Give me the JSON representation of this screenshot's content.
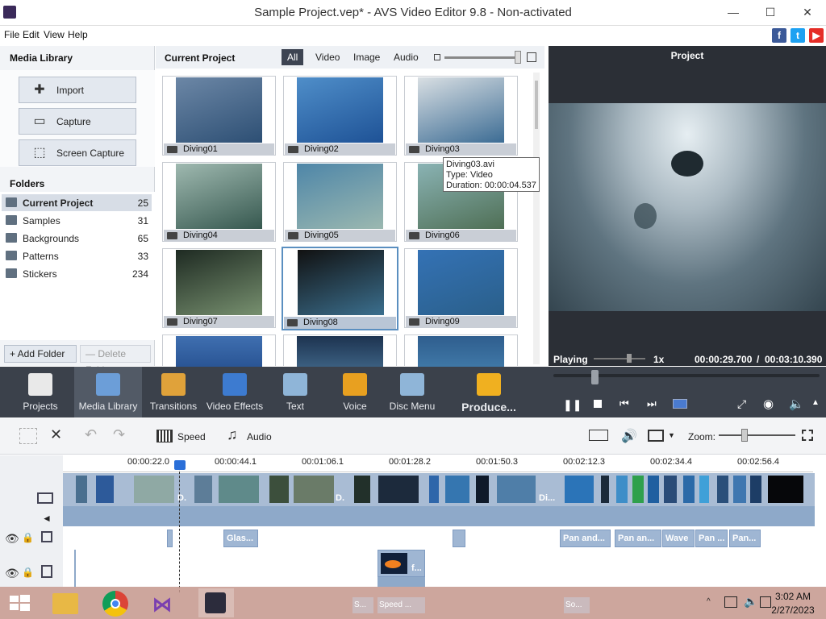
{
  "window": {
    "title": "Sample Project.vep* - AVS Video Editor 9.8 - Non-activated",
    "minimize": "—",
    "maximize": "☐",
    "close": "✕"
  },
  "menu": [
    "File",
    "Edit",
    "View",
    "Help"
  ],
  "social": [
    "f",
    "t",
    "▶"
  ],
  "media_library": {
    "title": "Media Library",
    "buttons": [
      {
        "label": "Import",
        "icon": "plus-icon"
      },
      {
        "label": "Capture",
        "icon": "camera-icon"
      },
      {
        "label": "Screen Capture",
        "icon": "monitor-icon"
      }
    ],
    "folders_title": "Folders",
    "folders": [
      {
        "name": "Current Project",
        "count": "25"
      },
      {
        "name": "Samples",
        "count": "31"
      },
      {
        "name": "Backgrounds",
        "count": "65"
      },
      {
        "name": "Patterns",
        "count": "33"
      },
      {
        "name": "Stickers",
        "count": "234"
      }
    ],
    "add_folder": "+ Add Folder",
    "delete_folder": "— Delete Folder"
  },
  "current_project": {
    "title": "Current Project",
    "filters": [
      "All",
      "Video",
      "Image",
      "Audio"
    ],
    "active_filter": "All",
    "items": [
      "Diving01",
      "Diving02",
      "Diving03",
      "Diving04",
      "Diving05",
      "Diving06",
      "Diving07",
      "Diving08",
      "Diving09"
    ],
    "tooltip": {
      "name": "Diving03.avi",
      "type": "Type: Video",
      "duration": "Duration: 00:00:04.537"
    }
  },
  "preview": {
    "title": "Project",
    "status": "Playing",
    "speed": "1x",
    "current_time": "00:00:29.700",
    "sep": "/",
    "total_time": "00:03:10.390"
  },
  "toolbar": [
    {
      "label": "Projects",
      "color": "#e9e9e9"
    },
    {
      "label": "Media Library",
      "color": "#6c9ed8"
    },
    {
      "label": "Transitions",
      "color": "#e0a23a"
    },
    {
      "label": "Video Effects",
      "color": "#3d7bd0"
    },
    {
      "label": "Text",
      "color": "#8fb5d8"
    },
    {
      "label": "Voice",
      "color": "#e8a020"
    },
    {
      "label": "Disc Menu",
      "color": "#8fb5d8"
    },
    {
      "label": "Produce...",
      "color": "#f0b020"
    }
  ],
  "timeline_toolbar": {
    "speed": "Speed",
    "audio": "Audio",
    "zoom": "Zoom:"
  },
  "ruler": [
    "00:00:22.0",
    "00:00:44.1",
    "00:01:06.1",
    "00:01:28.2",
    "00:01:50.3",
    "00:02:12.3",
    "00:02:34.4",
    "00:02:56.4"
  ],
  "effects": [
    "Glas...",
    "Pan and...",
    "Pan an...",
    "Wave",
    "Pan ...",
    "Pan..."
  ],
  "overlay_clip": "f...",
  "video_track_labels": [
    "D.",
    "D.",
    "Di..."
  ],
  "hidden_row": [
    "S...",
    "Speed ...",
    "So..."
  ],
  "taskbar": {
    "time": "3:02 AM",
    "date": "2/27/2023"
  }
}
